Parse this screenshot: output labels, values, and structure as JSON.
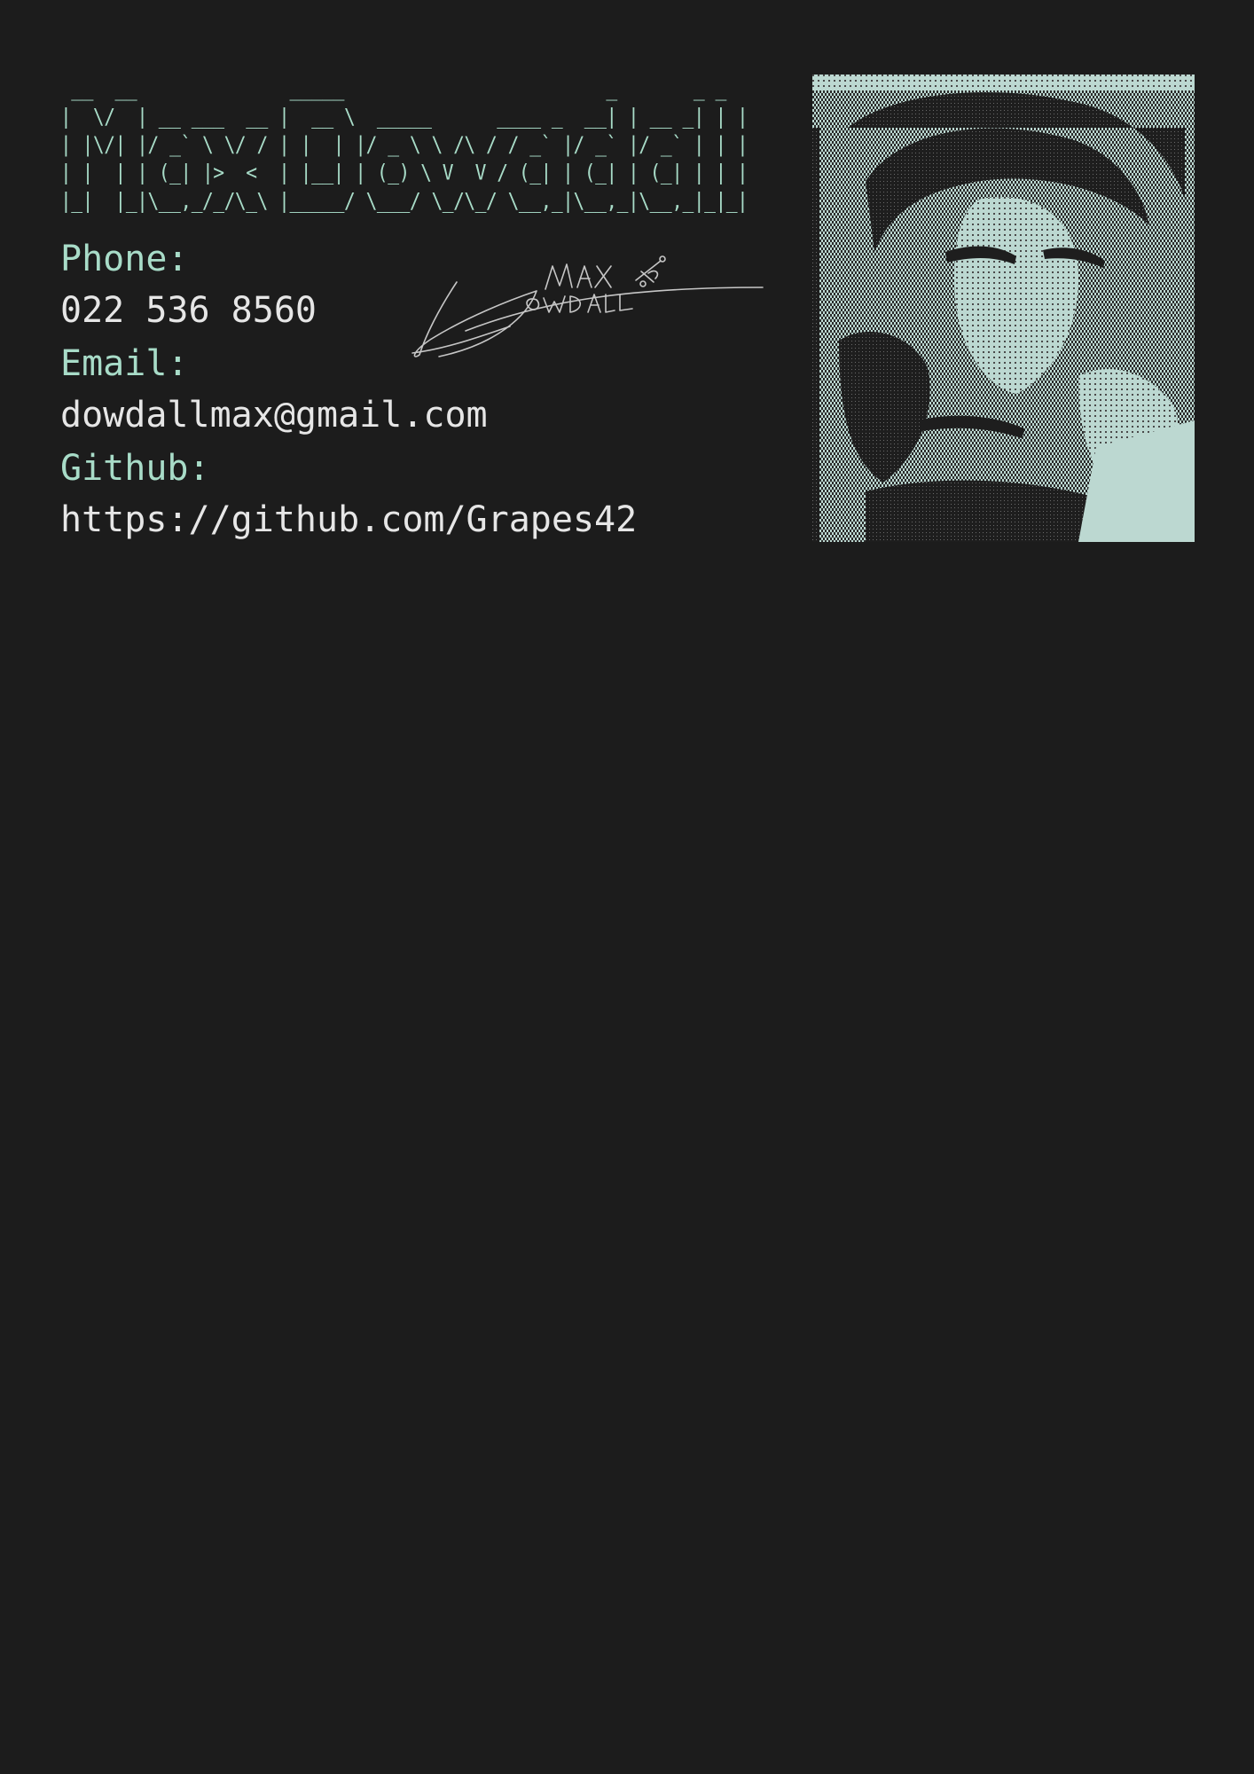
{
  "header": {
    "name_ascii_art": " __  __              _____                        _       _ _ \n|  \\/  | __ ___  __ |  __ \\  _____      ____ _  __| | __ _| | |\n| |\\/| |/ _` \\ \\/ / | |  | |/ _ \\ \\ /\\ / / _` |/ _` |/ _` | | |\n| |  | | (_| |>  <  | |__| | (_) \\ V  V / (_| | (_| | (_| | | |\n|_|  |_|\\__,_/_/\\_\\ |_____/ \\___/ \\_/\\_/ \\__,_|\\__,_|\\__,_|_|_|"
  },
  "contact": {
    "phone_label": "Phone:",
    "phone_value": "022 536 8560",
    "email_label": "Email:",
    "email_value": "dowdallmax@gmail.com",
    "github_label": "Github:",
    "github_value": "https://github.com/Grapes42"
  },
  "signature": {
    "text_line1": "MAX",
    "text_line2": "DOWDALL"
  },
  "colors": {
    "background": "#1c1c1c",
    "accent": "#a8dcc8",
    "text": "#e6e6e6",
    "portrait_light": "#bcd8d1",
    "portrait_dark": "#1c1c1c"
  }
}
